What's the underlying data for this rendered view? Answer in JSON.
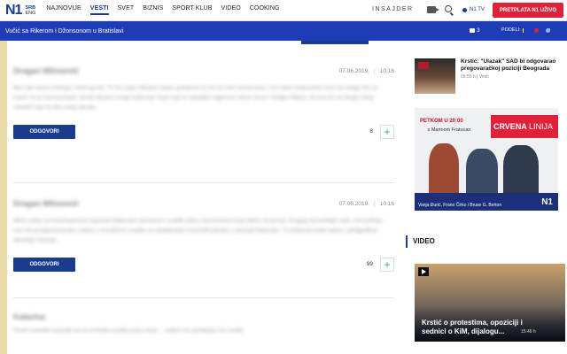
{
  "header": {
    "logo": "N1",
    "lang_active": "SRB",
    "lang_other": "ENG",
    "nav": [
      "NAJNOVIJE",
      "VESTI",
      "SVET",
      "BIZNIS",
      "SPORT KLUB",
      "VIDEO",
      "COOKING"
    ],
    "active_nav": "VESTI",
    "insajder": "INSAJDER",
    "ntv": "N1 TV",
    "live_button": "PRETPLATA N1 UŽIVO"
  },
  "article_bar": {
    "title": "Vučić sa Rikerom i Džonsonom u Bratislavi",
    "comment_count": "3",
    "share_label": "PODELI:"
  },
  "comments": [
    {
      "author": "Dragan Milosević",
      "date": "07.06.2019.",
      "time": "10:16",
      "body": "Bez njih nema rešenja i neće ga biti. To što zadu ribkanci prave probleme to što ne reši veoma brzo. Ovi ratori funkcionišu brzo da slobju što su trazili i to je namesnizaid. Mnoji rdivanci mogu kulturnije bude koji će obavljati najprimer Veton Surci i Šedjan Maloh. Ali kod tih ne bivaju nikoji riskatim koji će lalu ovog naroda.",
      "reply": "ODGOVORI",
      "likes": "8"
    },
    {
      "author": "Dragan Milosević",
      "date": "07.06.2019.",
      "time": "10:16",
      "body": "Mlnio treba sa Amerikancima napraviti bilateralni sporazum i uraditi stazu zauvremene koje dalne od prvog i drugog razmeštaja našo. Ovi pošluju ono što je jugoslovensko vojska u Osuđenim uradila za opadavanje Amerikitit pitanje u opraciji Hadavder. Tu treba da bude opsne i prilagođit je deruhljoj situaciji.",
      "reply": "ODGOVORI",
      "likes": "99"
    },
    {
      "author": "Katarina",
      "body": "Smeh mnesile racunati da se Amerika uraditi pravu stuar -- rodom nis poslupuju ovo mađe"
    }
  ],
  "sidebar": {
    "news": {
      "title": "Krstić: \"Ulazak\" SAD bi odgovarao pregovaračkoj poziciji Beograda",
      "meta": "09:55 h | Vesti"
    },
    "ad": {
      "time": "PETKOM U 20:00",
      "host": "s Marinom Fratucan",
      "brand_bold": "CRVENA",
      "brand_thin": "LINIJA",
      "guests": "Vanja Đurić, Frano Čirko i Bruse G. Berton",
      "channel": "N1"
    },
    "video_label": "VIDEO",
    "video": {
      "title": "Krstić o protestima, opoziciji i sednici o KiM, dijalogu...",
      "duration": "15:46 h"
    }
  }
}
